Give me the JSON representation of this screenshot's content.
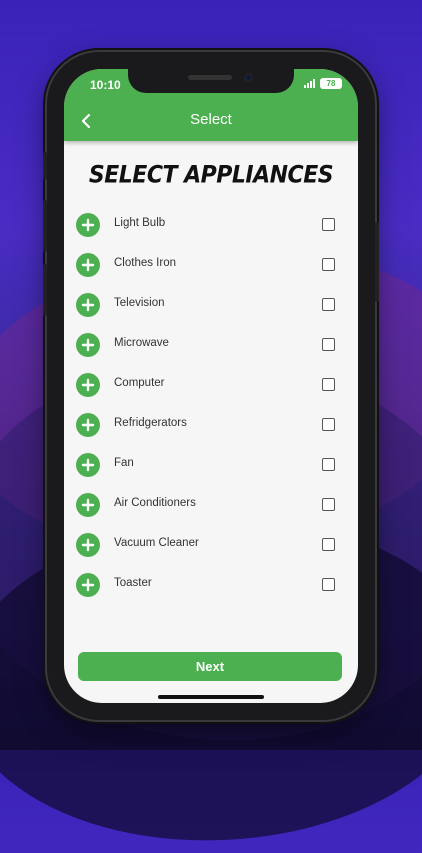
{
  "status_bar": {
    "time": "10:10",
    "battery": "78"
  },
  "appbar": {
    "title": "Select",
    "back_icon": "chevron-left-icon"
  },
  "heading": "SELECT APPLIANCES",
  "appliances": [
    {
      "label": "Light Bulb",
      "checked": false
    },
    {
      "label": "Clothes Iron",
      "checked": false
    },
    {
      "label": "Television",
      "checked": false
    },
    {
      "label": "Microwave",
      "checked": false
    },
    {
      "label": "Computer",
      "checked": false
    },
    {
      "label": "Refridgerators",
      "checked": false
    },
    {
      "label": "Fan",
      "checked": false
    },
    {
      "label": "Air Conditioners",
      "checked": false
    },
    {
      "label": "Vacuum Cleaner",
      "checked": false
    },
    {
      "label": "Toaster",
      "checked": false
    }
  ],
  "next_button": {
    "label": "Next"
  },
  "colors": {
    "primary": "#4caf50",
    "background": "#f6f6f6"
  }
}
